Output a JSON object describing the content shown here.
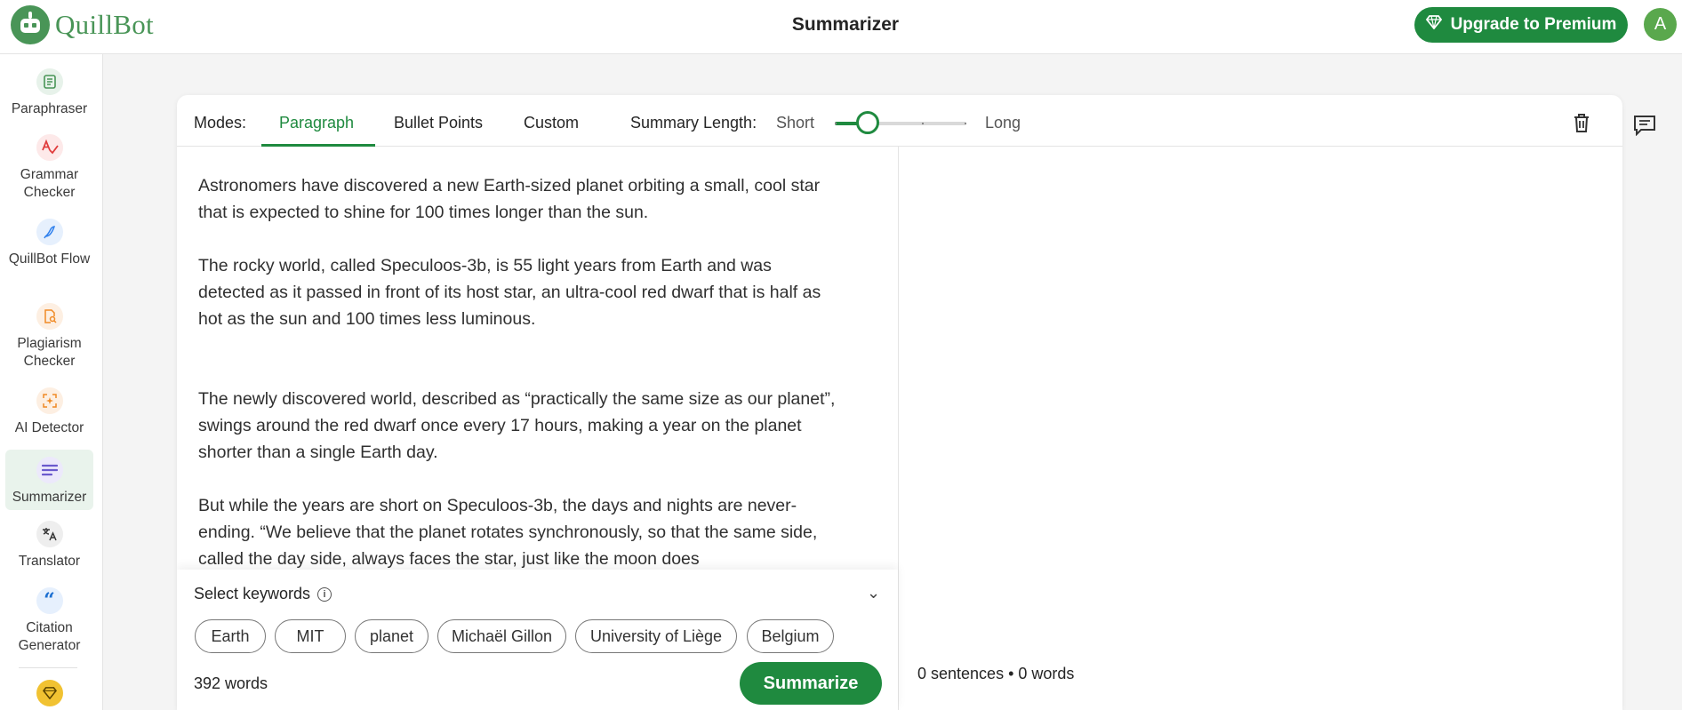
{
  "header": {
    "logo_text": "QuillBot",
    "title": "Summarizer",
    "upgrade_label": "Upgrade to Premium",
    "avatar_initial": "A"
  },
  "sidebar": {
    "items": [
      {
        "label": "Paraphraser",
        "icon": "paraphraser-icon",
        "color": "#499557"
      },
      {
        "label": "Grammar Checker",
        "icon": "grammar-icon",
        "color": "#e03b3b"
      },
      {
        "label": "QuillBot Flow",
        "icon": "flow-icon",
        "color": "#2f80ed"
      },
      {
        "label": "Plagiarism Checker",
        "icon": "plagiarism-icon",
        "color": "#f08a24"
      },
      {
        "label": "AI Detector",
        "icon": "ai-detector-icon",
        "color": "#f08a24"
      },
      {
        "label": "Summarizer",
        "icon": "summarizer-icon",
        "color": "#6a5acd"
      },
      {
        "label": "Translator",
        "icon": "translator-icon",
        "color": "#333333"
      },
      {
        "label": "Citation Generator",
        "icon": "citation-icon",
        "color": "#1c6fd1"
      }
    ],
    "premium_icon": "diamond-icon"
  },
  "toolbar": {
    "modes_label": "Modes:",
    "modes": [
      "Paragraph",
      "Bullet Points",
      "Custom"
    ],
    "active_mode": "Paragraph",
    "summary_length_label": "Summary Length:",
    "short_label": "Short",
    "long_label": "Long",
    "slider_value": 0.25
  },
  "input": {
    "paragraphs": [
      "Astronomers have discovered a new Earth-sized planet orbiting a small, cool star that is expected to shine for 100 times longer than the sun.",
      "The rocky world, called Speculoos-3b, is 55 light years from Earth and was detected as it passed in front of its host star, an ultra-cool red dwarf that is half as hot as the sun and 100 times less luminous.",
      "The newly discovered world, described as “practically the same size as our planet”, swings around the red dwarf once every 17 hours, making a year on the planet shorter than a single Earth day.",
      "But while the years are short on Speculoos-3b, the days and nights are never-ending. “We believe that the planet rotates synchronously, so that the same side, called the day side, always faces the star, just like the moon does"
    ]
  },
  "keywords": {
    "title": "Select keywords",
    "chips": [
      "Earth",
      "MIT",
      "planet",
      "Michaël Gillon",
      "University of Liège",
      "Belgium"
    ]
  },
  "footer": {
    "word_count": "392 words",
    "summarize_label": "Summarize",
    "output_stats": "0 sentences • 0 words"
  },
  "colors": {
    "brand_green": "#1f8a3f",
    "logo_green": "#499557"
  }
}
